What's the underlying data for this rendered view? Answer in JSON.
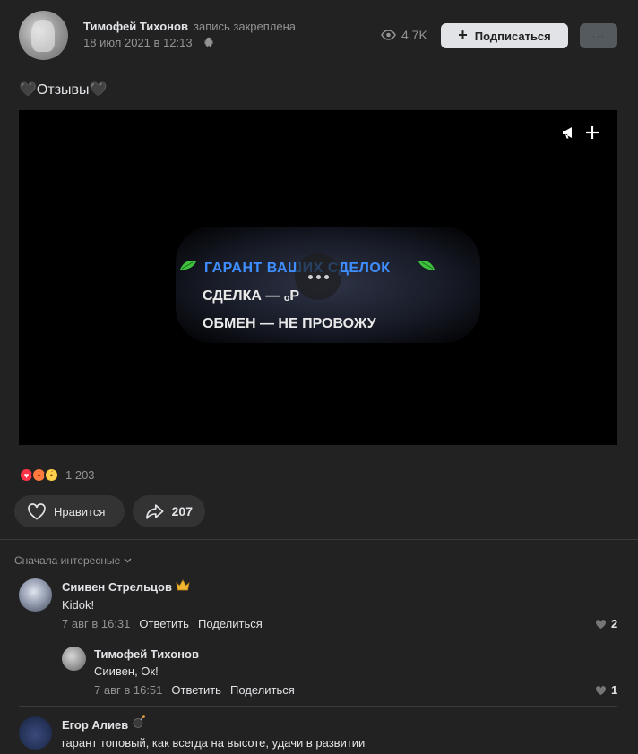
{
  "post": {
    "author_name": "Тимофей Тихонов",
    "pinned_note": "запись закреплена",
    "date": "18 июл 2021 в 12:13",
    "views": "4.7K",
    "subscribe_label": "Подписаться",
    "more_label": "···",
    "text": "🖤Отзывы🖤"
  },
  "video": {
    "line1": "ГАРАНТ ВАШИХ СДЕЛОК",
    "line2": "СДЕЛКА —  ₒР",
    "line3": "ОБМЕН   —   НЕ ПРОВОЖУ"
  },
  "reactions": {
    "icons": [
      "heart-reaction",
      "angry-reaction",
      "sad-reaction"
    ],
    "count": "1 203"
  },
  "actions": {
    "like_label": "Нравится",
    "share_count": "207"
  },
  "comments_sort": "Сначала интересные",
  "comments": [
    {
      "author": "Сиивен Стрельцов",
      "text": "Kidok!",
      "date": "7 авг в 16:31",
      "reply_label": "Ответить",
      "share_label": "Поделиться",
      "likes": "2"
    },
    {
      "author": "Тимофей Тихонов",
      "text": "Сиивен, Ок!",
      "date": "7 авг в 16:51",
      "reply_label": "Ответить",
      "share_label": "Поделиться",
      "likes": "1"
    },
    {
      "author": "Егор Алиев",
      "text": "гарант топовый, как всегда на высоте, удачи в развитии"
    }
  ],
  "colors": {
    "background": "#222222",
    "text_primary": "#e1e3e6",
    "text_secondary": "#939393",
    "video_accent": "#3e8eff"
  }
}
